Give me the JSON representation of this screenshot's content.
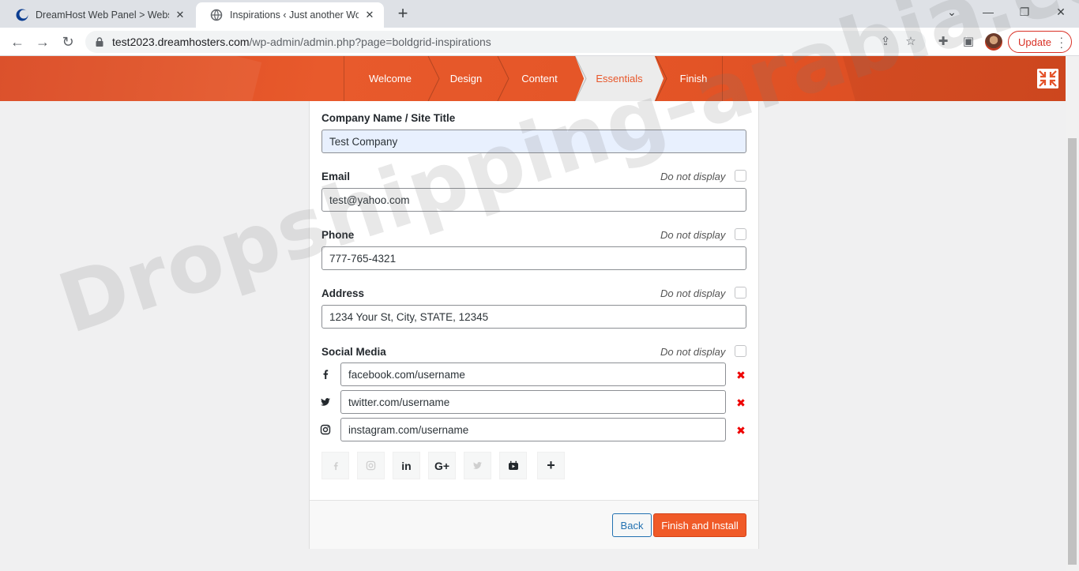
{
  "browser": {
    "tabs": [
      {
        "title": "DreamHost Web Panel > Websites",
        "active": false
      },
      {
        "title": "Inspirations ‹ Just another WordPress site",
        "active": true
      }
    ],
    "url_host": "test2023.dreamhosters.com",
    "url_path": "/wp-admin/admin.php?page=boldgrid-inspirations",
    "update_label": "Update"
  },
  "wizard": {
    "steps": [
      "Welcome",
      "Design",
      "Content",
      "Essentials",
      "Finish"
    ],
    "active_step": "Essentials",
    "accent_color": "#e8572a"
  },
  "form": {
    "company_label": "Company Name / Site Title",
    "company_value": "Test Company",
    "email_label": "Email",
    "email_value": "test@yahoo.com",
    "phone_label": "Phone",
    "phone_value": "777-765-4321",
    "address_label": "Address",
    "address_value": "1234 Your St, City, STATE, 12345",
    "social_label": "Social Media",
    "do_not_display": "Do not display",
    "social": [
      {
        "icon": "facebook-icon",
        "value": "facebook.com/username"
      },
      {
        "icon": "twitter-icon",
        "value": "twitter.com/username"
      },
      {
        "icon": "instagram-icon",
        "value": "instagram.com/username"
      }
    ],
    "add_networks": [
      "facebook-icon",
      "instagram-icon",
      "linkedin-icon",
      "google-plus-icon",
      "twitter-icon",
      "youtube-icon",
      "plus-icon"
    ],
    "back_label": "Back",
    "finish_label": "Finish and Install"
  },
  "watermark": "Dropshipping-arabia.com"
}
